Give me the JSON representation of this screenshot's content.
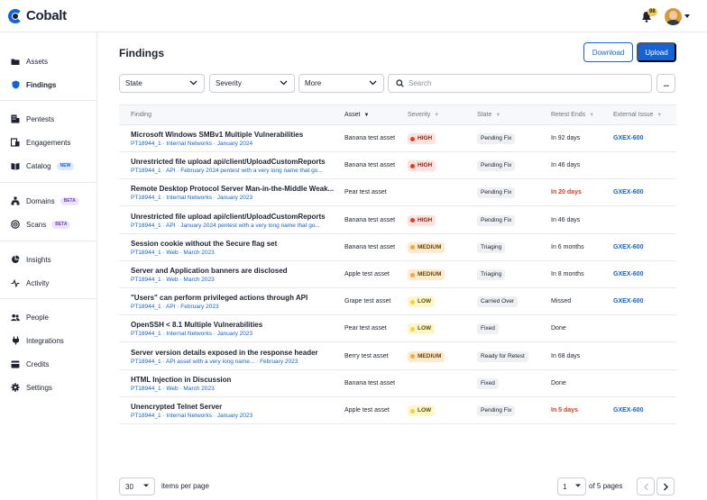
{
  "app": {
    "name": "Cobalt",
    "notifications": "98"
  },
  "sidebar": {
    "groups": [
      [
        {
          "label": "Assets",
          "icon": "folder-icon"
        },
        {
          "label": "Findings",
          "icon": "shield-icon",
          "active": true
        }
      ],
      [
        {
          "label": "Pentests",
          "icon": "building-icon"
        },
        {
          "label": "Engagements",
          "icon": "engagements-icon"
        },
        {
          "label": "Catalog",
          "icon": "book-icon",
          "badge": "NEW"
        }
      ],
      [
        {
          "label": "Domains",
          "icon": "sitemap-icon",
          "badge": "BETA"
        },
        {
          "label": "Scans",
          "icon": "radar-icon",
          "badge": "BETA"
        }
      ],
      [
        {
          "label": "Insights",
          "icon": "pie-chart-icon"
        },
        {
          "label": "Activity",
          "icon": "pulse-icon"
        }
      ],
      [
        {
          "label": "People",
          "icon": "people-icon"
        },
        {
          "label": "Integrations",
          "icon": "plug-icon"
        },
        {
          "label": "Credits",
          "icon": "credit-card-icon"
        },
        {
          "label": "Settings",
          "icon": "gear-icon"
        }
      ]
    ]
  },
  "page": {
    "title": "Findings",
    "download_label": "Download",
    "upload_label": "Upload"
  },
  "filters": {
    "state": "State",
    "severity": "Severity",
    "more": "More",
    "search_placeholder": "Search",
    "overflow": "..."
  },
  "table": {
    "headers": {
      "finding": "Finding",
      "asset": "Asset",
      "severity": "Severity",
      "state": "State",
      "retest": "Retest Ends",
      "external": "External Issue"
    },
    "rows": [
      {
        "title": "Microsoft Windows SMBv1 Multiple Vulnerabilities",
        "sub": "PT18944_1 · Internal Networks · January 2024",
        "asset": "Banana test asset",
        "severity": "HIGH",
        "sev_class": "high",
        "state": "Pending Fix",
        "retest": "In 92 days",
        "retest_red": false,
        "external": "GXEX-600"
      },
      {
        "title": "Unrestricted file upload api/client/UploadCustomReports",
        "sub": "PT18944_1 · API · February 2024 pentest with a very long name that go...",
        "asset": "Banana test asset",
        "severity": "HIGH",
        "sev_class": "high",
        "state": "Pending Fix",
        "retest": "In 46 days",
        "retest_red": false,
        "external": ""
      },
      {
        "title": "Remote Desktop Protocol Server Man-in-the-Middle Weak...",
        "sub": "PT18944_1 · Internal Networks · January 2023",
        "asset": "Pear test asset",
        "severity": "",
        "sev_class": "",
        "state": "Pending Fix",
        "retest": "In 20 days",
        "retest_red": true,
        "external": "GXEX-600"
      },
      {
        "title": "Unrestricted file upload api/client/UploadCustomReports",
        "sub": "PT18944_1 · API · January 2024 pentest with a very long name that go...",
        "asset": "Banana test asset",
        "severity": "HIGH",
        "sev_class": "high",
        "state": "Pending Fix",
        "retest": "In 46 days",
        "retest_red": false,
        "external": ""
      },
      {
        "title": "Session cookie without the Secure flag set",
        "sub": "PT18944_1 · Web · March 2023",
        "asset": "Banana test asset",
        "severity": "MEDIUM",
        "sev_class": "medium",
        "state": "Triaging",
        "retest": "In 6 months",
        "retest_red": false,
        "external": "GXEX-600"
      },
      {
        "title": "Server and Application banners are disclosed",
        "sub": "PT18944_1 · Web · March 2023",
        "asset": "Apple test asset",
        "severity": "MEDIUM",
        "sev_class": "medium",
        "state": "Triaging",
        "retest": "In 8 months",
        "retest_red": false,
        "external": "GXEX-600"
      },
      {
        "title": "\"Users\" can perform privileged actions through API",
        "sub": "PT18944_1 · API · February 2023",
        "asset": "Grape test asset",
        "severity": "LOW",
        "sev_class": "low",
        "state": "Carried Over",
        "retest": "Missed",
        "retest_red": false,
        "external": "GXEX-600"
      },
      {
        "title": "OpenSSH < 8.1 Multiple Vulnerabilities",
        "sub": "PT18944_1 · Internal Networks · January 2023",
        "asset": "Pear test asset",
        "severity": "LOW",
        "sev_class": "low",
        "state": "Fixed",
        "retest": "Done",
        "retest_red": false,
        "external": ""
      },
      {
        "title": "Server version details exposed in the response header",
        "sub": "PT18944_1 · API asset with a very long name... · February 2023",
        "asset": "Berry test asset",
        "severity": "MEDIUM",
        "sev_class": "medium",
        "state": "Ready for Retest",
        "retest": "In 68 days",
        "retest_red": false,
        "external": ""
      },
      {
        "title": "HTML Injection in Discussion",
        "sub": "PT18944_1 · Web · March 2023",
        "asset": "Banana test asset",
        "severity": "",
        "sev_class": "",
        "state": "Fixed",
        "retest": "Done",
        "retest_red": false,
        "external": ""
      },
      {
        "title": "Unencrypted Telnet Server",
        "sub": "PT18944_1 · Internal Networks · January 2023",
        "asset": "Apple test asset",
        "severity": "LOW",
        "sev_class": "low",
        "state": "Pending Fix",
        "retest": "In 5 days",
        "retest_red": true,
        "external": "GXEX-600"
      }
    ]
  },
  "pagination": {
    "per_page": "30",
    "per_page_label": "items per page",
    "current_page": "1",
    "of_pages": "of 5 pages"
  },
  "colors": {
    "accent": "#1463d8",
    "high": "#e23b2a",
    "medium": "#f2a93b",
    "low": "#f2d33b",
    "overdue": "#d93b20"
  }
}
